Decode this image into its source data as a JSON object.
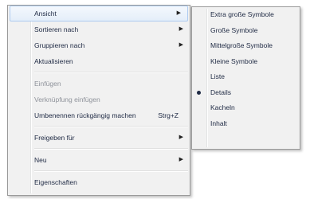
{
  "main_menu": {
    "items": [
      {
        "label": "Ansicht",
        "submenu": true
      },
      {
        "label": "Sortieren nach",
        "submenu": true
      },
      {
        "label": "Gruppieren nach",
        "submenu": true
      },
      {
        "label": "Aktualisieren"
      },
      {
        "label": "Einfügen",
        "disabled": true
      },
      {
        "label": "Verknüpfung einfügen",
        "disabled": true
      },
      {
        "label": "Umbenennen rückgängig machen",
        "shortcut": "Strg+Z"
      },
      {
        "label": "Freigeben für",
        "submenu": true
      },
      {
        "label": "Neu",
        "submenu": true
      },
      {
        "label": "Eigenschaften"
      }
    ]
  },
  "view_submenu": {
    "items": [
      {
        "label": "Extra große Symbole"
      },
      {
        "label": "Große Symbole"
      },
      {
        "label": "Mittelgroße Symbole"
      },
      {
        "label": "Kleine Symbole"
      },
      {
        "label": "Liste"
      },
      {
        "label": "Details",
        "selected": true
      },
      {
        "label": "Kacheln"
      },
      {
        "label": "Inhalt"
      }
    ]
  },
  "icons": {
    "submenu_arrow": "arrow-right-icon",
    "selected_bullet": "bullet-icon"
  }
}
